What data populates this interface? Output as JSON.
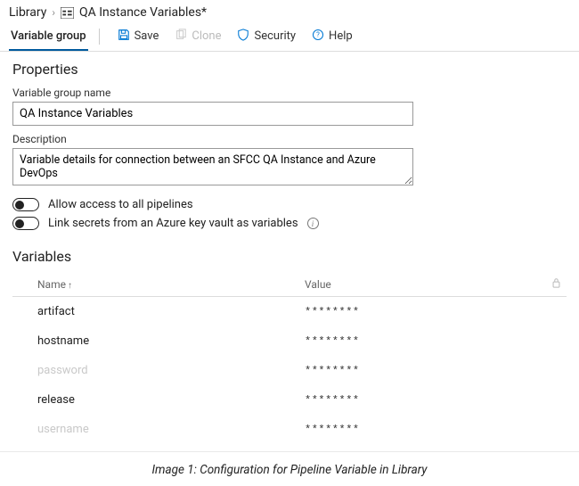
{
  "breadcrumb": {
    "root": "Library",
    "page_title": "QA Instance Variables*"
  },
  "tabs": {
    "active": "Variable group"
  },
  "toolbar": {
    "save": "Save",
    "clone": "Clone",
    "security": "Security",
    "help": "Help"
  },
  "properties": {
    "heading": "Properties",
    "name_label": "Variable group name",
    "name_value": "QA Instance Variables",
    "desc_label": "Description",
    "desc_value": "Variable details for connection between an SFCC QA Instance and Azure DevOps",
    "toggle1": "Allow access to all pipelines",
    "toggle2": "Link secrets from an Azure key vault as variables"
  },
  "variables": {
    "heading": "Variables",
    "col_name": "Name",
    "col_value": "Value",
    "rows": [
      {
        "name": "artifact",
        "value": "********",
        "muted": false
      },
      {
        "name": "hostname",
        "value": "********",
        "muted": false
      },
      {
        "name": "password",
        "value": "********",
        "muted": true
      },
      {
        "name": "release",
        "value": "********",
        "muted": false
      },
      {
        "name": "username",
        "value": "********",
        "muted": true
      }
    ]
  },
  "caption": "Image 1: Configuration for Pipeline Variable in Library"
}
